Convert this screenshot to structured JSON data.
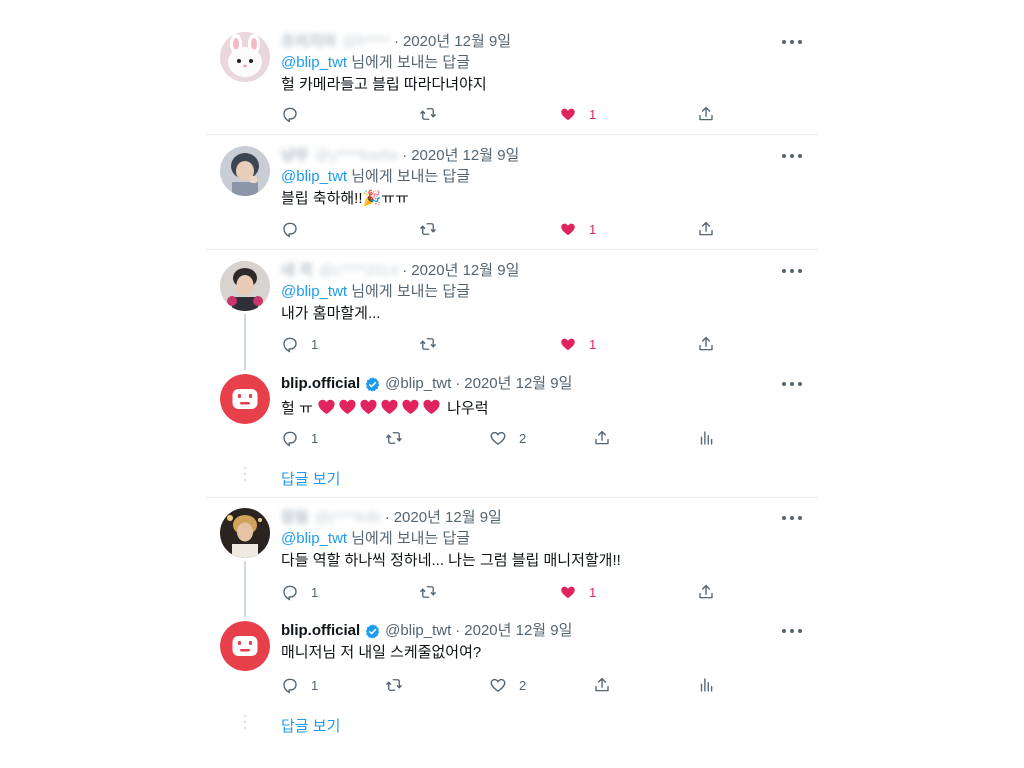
{
  "tweets": [
    {
      "name": "프리지아",
      "handle": "@fr****",
      "time": "2020년 12월 9일",
      "replying_prefix": "@blip_twt",
      "replying_suffix": " 님에게 보내는 답글",
      "text": "헐 카메라들고 블립 따라다녀야지",
      "reply_count": "",
      "like_count": "1",
      "liked": true
    },
    {
      "name": "냥무",
      "handle": "@y****kwdw",
      "time": "2020년 12월 9일",
      "replying_prefix": "@blip_twt",
      "replying_suffix": " 님에게 보내는 답글",
      "text": "블립 축하해!!🎉ㅠㅠ",
      "reply_count": "",
      "like_count": "1",
      "liked": true
    },
    {
      "name": "네 끼",
      "handle": "@c****2014",
      "time": "2020년 12월 9일",
      "replying_prefix": "@blip_twt",
      "replying_suffix": " 님에게 보내는 답글",
      "text": "내가 홈마할게...",
      "reply_count": "1",
      "like_count": "1",
      "liked": true
    },
    {
      "name": "blip.official",
      "handle": "@blip_twt",
      "time": "2020년 12월 9일",
      "text_before": "헐 ㅠ ",
      "text_after": " 나우럭",
      "hearts": 6,
      "reply_count": "1",
      "like_count": "2",
      "liked": false
    },
    {
      "name": "잠됨",
      "handle": "@j****kdb",
      "time": "2020년 12월 9일",
      "replying_prefix": "@blip_twt",
      "replying_suffix": " 님에게 보내는 답글",
      "text": "다들 역할 하나씩 정하네... 나는 그럼 블립 매니저할개!!",
      "reply_count": "1",
      "like_count": "1",
      "liked": true
    },
    {
      "name": "blip.official",
      "handle": "@blip_twt",
      "time": "2020년 12월 9일",
      "text": "매니저님 저 내일 스케줄없어여?",
      "reply_count": "1",
      "like_count": "2",
      "liked": false
    }
  ],
  "show_replies_label": "답글 보기",
  "dot": "·",
  "colors": {
    "accent": "#1d9bf0",
    "like": "#e0245e",
    "muted": "#536471",
    "blip_red": "#e8404b"
  },
  "icons": [
    "reply-icon",
    "retweet-icon",
    "like-icon",
    "share-icon",
    "analytics-icon",
    "verified-badge-icon",
    "more-icon"
  ]
}
